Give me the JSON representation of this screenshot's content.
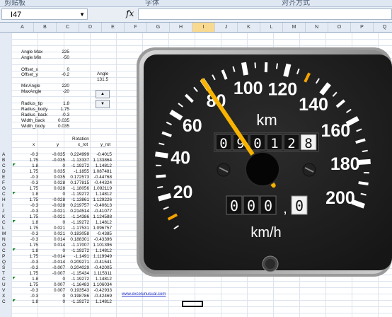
{
  "ribbon": {
    "groups": [
      "剪贴板",
      "字体",
      "对齐方式"
    ]
  },
  "formula_bar": {
    "name_box": "I47",
    "fx": "fx",
    "formula": ""
  },
  "columns": [
    "A",
    "B",
    "C",
    "D",
    "E",
    "F",
    "G",
    "H",
    "I",
    "J",
    "K",
    "L",
    "M",
    "N",
    "O",
    "P",
    "Q"
  ],
  "selected_column": "I",
  "params": [
    {
      "label": "Angle Max",
      "value": "225"
    },
    {
      "label": "Angle Min",
      "value": "-50"
    },
    {
      "label": "Offset_x",
      "value": "0"
    },
    {
      "label": "Offset_y",
      "value": "-0.2"
    },
    {
      "label": "MinAngle",
      "value": "220"
    },
    {
      "label": "MaxAngle",
      "value": "-20"
    },
    {
      "label": "Radius_tip",
      "value": "1.8"
    },
    {
      "label": "Radius_body",
      "value": "1.75"
    },
    {
      "label": "Radius_back",
      "value": "-0.3"
    },
    {
      "label": "Width_back",
      "value": "0.035"
    },
    {
      "label": "Width_body",
      "value": "0.035"
    }
  ],
  "angle_box": {
    "label": "Angle",
    "value": "131.5"
  },
  "table_headers": {
    "x": "x",
    "y": "y",
    "rot_title": "Rotation",
    "x_rot": "x_rot",
    "y_rot": "y_rot"
  },
  "rows": [
    {
      "k": "A",
      "x": "-0.3",
      "y": "-0.035",
      "xr": "0.224999",
      "yr": "-0.4015"
    },
    {
      "k": "B",
      "x": "1.75",
      "y": "-0.035",
      "xr": "-1.13337",
      "yr": "1.133864"
    },
    {
      "k": "C",
      "x": "1.8",
      "y": "0",
      "xr": "-1.19272",
      "yr": "1.14812"
    },
    {
      "k": "D",
      "x": "1.75",
      "y": "0.035",
      "xr": "-1.1855",
      "yr": "1.087481"
    },
    {
      "k": "E",
      "x": "-0.3",
      "y": "0.035",
      "xr": "0.172573",
      "yr": "-0.44768"
    },
    {
      "k": "F",
      "x": "-0.3",
      "y": "0.028",
      "xr": "0.177815",
      "yr": "-0.44324"
    },
    {
      "k": "G",
      "x": "1.75",
      "y": "0.028",
      "xr": "-1.18056",
      "yr": "1.092119"
    },
    {
      "k": "C",
      "x": "1.8",
      "y": "0",
      "xr": "-1.19272",
      "yr": "1.14812"
    },
    {
      "k": "H",
      "x": "1.75",
      "y": "-0.028",
      "xr": "-1.13861",
      "yr": "1.129226"
    },
    {
      "k": "I",
      "x": "-0.3",
      "y": "-0.028",
      "xr": "0.219757",
      "yr": "-0.40613"
    },
    {
      "k": "J",
      "x": "-0.3",
      "y": "-0.021",
      "xr": "0.214514",
      "yr": "-0.41077"
    },
    {
      "k": "K",
      "x": "1.75",
      "y": "-0.021",
      "xr": "-1.14386",
      "yr": "1.124588"
    },
    {
      "k": "C",
      "x": "1.8",
      "y": "0",
      "xr": "-1.19272",
      "yr": "1.14812"
    },
    {
      "k": "L",
      "x": "1.75",
      "y": "0.021",
      "xr": "-1.17531",
      "yr": "1.096757"
    },
    {
      "k": "M",
      "x": "-0.3",
      "y": "0.021",
      "xr": "0.183058",
      "yr": "-0.4385"
    },
    {
      "k": "N",
      "x": "-0.3",
      "y": "0.014",
      "xr": "0.188301",
      "yr": "-0.43396"
    },
    {
      "k": "O",
      "x": "1.75",
      "y": "0.014",
      "xr": "-1.17007",
      "yr": "1.101396"
    },
    {
      "k": "C",
      "x": "1.8",
      "y": "0",
      "xr": "-1.19272",
      "yr": "1.14812"
    },
    {
      "k": "P",
      "x": "1.75",
      "y": "-0.014",
      "xr": "-1.1491",
      "yr": "1.119949"
    },
    {
      "k": "Q",
      "x": "-0.3",
      "y": "-0.014",
      "xr": "0.209271",
      "yr": "-0.41541"
    },
    {
      "k": "S",
      "x": "-0.3",
      "y": "-0.007",
      "xr": "0.204029",
      "yr": "-0.42005"
    },
    {
      "k": "T",
      "x": "1.75",
      "y": "-0.007",
      "xr": "-1.15434",
      "yr": "1.115311"
    },
    {
      "k": "C",
      "x": "1.8",
      "y": "0",
      "xr": "-1.19272",
      "yr": "1.14812"
    },
    {
      "k": "U",
      "x": "1.75",
      "y": "0.007",
      "xr": "-1.16483",
      "yr": "1.106034"
    },
    {
      "k": "V",
      "x": "-0.3",
      "y": "0.007",
      "xr": "0.193543",
      "yr": "-0.42933"
    },
    {
      "k": "X",
      "x": "-0.3",
      "y": "0",
      "xr": "0.198786",
      "yr": "-0.42469"
    },
    {
      "k": "C",
      "x": "1.8",
      "y": "0",
      "xr": "-1.19272",
      "yr": "1.14812"
    }
  ],
  "link_text": "www.excelunusual.com",
  "gauge": {
    "speed_labels": [
      "20",
      "40",
      "60",
      "80",
      "100",
      "120",
      "140",
      "160",
      "180",
      "200"
    ],
    "unit_top": "km",
    "unit_bottom": "km/h",
    "odometer": [
      "0",
      "9",
      "0",
      "1",
      "2",
      "8"
    ],
    "trip": [
      "0",
      "0",
      "0"
    ],
    "trip_sep": ",",
    "trip_decimal": "0",
    "speed_value": 80,
    "accent_color": "#f5a300",
    "needle_color": "#f7b300"
  }
}
